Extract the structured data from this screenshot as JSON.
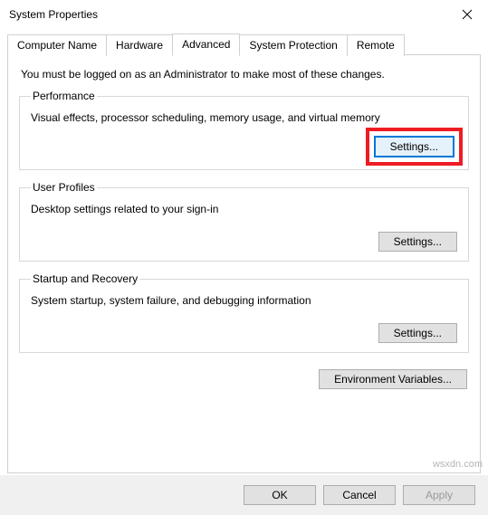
{
  "window": {
    "title": "System Properties"
  },
  "tabs": {
    "computer_name": "Computer Name",
    "hardware": "Hardware",
    "advanced": "Advanced",
    "system_protection": "System Protection",
    "remote": "Remote"
  },
  "intro": "You must be logged on as an Administrator to make most of these changes.",
  "groups": {
    "performance": {
      "legend": "Performance",
      "desc": "Visual effects, processor scheduling, memory usage, and virtual memory",
      "button": "Settings..."
    },
    "user_profiles": {
      "legend": "User Profiles",
      "desc": "Desktop settings related to your sign-in",
      "button": "Settings..."
    },
    "startup_recovery": {
      "legend": "Startup and Recovery",
      "desc": "System startup, system failure, and debugging information",
      "button": "Settings..."
    }
  },
  "env_button": "Environment Variables...",
  "bottom": {
    "ok": "OK",
    "cancel": "Cancel",
    "apply": "Apply"
  },
  "watermark": "wsxdn.com"
}
